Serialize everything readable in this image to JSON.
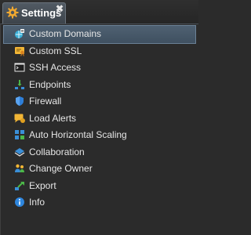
{
  "tab": {
    "title": "Settings",
    "close_glyph": "✖",
    "icon": "gear-icon"
  },
  "menu": {
    "selected_index": 0,
    "items": [
      {
        "label": "Custom Domains",
        "icon": "custom-domains-icon"
      },
      {
        "label": "Custom SSL",
        "icon": "certificate-icon"
      },
      {
        "label": "SSH Access",
        "icon": "terminal-icon"
      },
      {
        "label": "Endpoints",
        "icon": "endpoints-icon"
      },
      {
        "label": "Firewall",
        "icon": "shield-icon"
      },
      {
        "label": "Load Alerts",
        "icon": "alert-icon"
      },
      {
        "label": "Auto Horizontal Scaling",
        "icon": "scaling-icon"
      },
      {
        "label": "Collaboration",
        "icon": "collaboration-icon"
      },
      {
        "label": "Change Owner",
        "icon": "change-owner-icon"
      },
      {
        "label": "Export",
        "icon": "export-icon"
      },
      {
        "label": "Info",
        "icon": "info-icon"
      }
    ]
  },
  "colors": {
    "background": "#2b2b2b",
    "selected_row": "#4a5c6d",
    "tab_bg": "#4b545c",
    "text": "#e6e6e6",
    "gear": "#f0a830"
  }
}
